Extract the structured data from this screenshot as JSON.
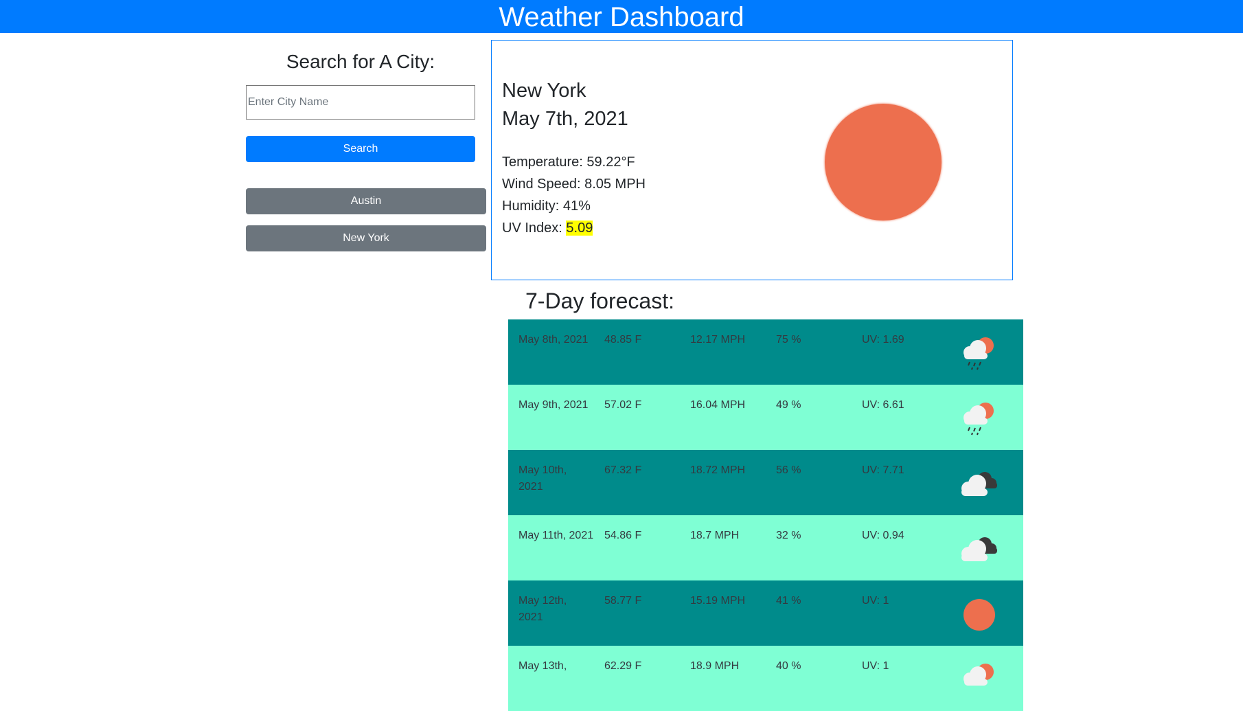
{
  "header": {
    "title": "Weather Dashboard"
  },
  "search": {
    "title": "Search for A City:",
    "placeholder": "Enter City Name",
    "value": "",
    "button_label": "Search"
  },
  "history": [
    "Austin",
    "New York"
  ],
  "current": {
    "city": "New York",
    "date": "May 7th, 2021",
    "temperature": "Temperature: 59.22°F",
    "wind": "Wind Speed: 8.05 MPH",
    "humidity": "Humidity: 41%",
    "uv_label": "UV Index: ",
    "uv_value": "5.09",
    "uv_highlight_color": "#ffff00",
    "icon": "sun-icon"
  },
  "forecast": {
    "title": "7-Day forecast:",
    "row_colors": [
      "#008b8b",
      "#7fffd4"
    ],
    "days": [
      {
        "date": "May 8th, 2021",
        "temp": "48.85 F",
        "wind": "12.17 MPH",
        "humidity": "75 %",
        "uv": "UV: 1.69",
        "icon": "rain-sun-icon"
      },
      {
        "date": "May 9th, 2021",
        "temp": "57.02 F",
        "wind": "16.04 MPH",
        "humidity": "49 %",
        "uv": "UV: 6.61",
        "icon": "rain-sun-icon"
      },
      {
        "date": "May 10th, 2021",
        "temp": "67.32 F",
        "wind": "18.72 MPH",
        "humidity": "56 %",
        "uv": "UV: 7.71",
        "icon": "cloudy-icon"
      },
      {
        "date": "May 11th, 2021",
        "temp": "54.86 F",
        "wind": "18.7 MPH",
        "humidity": "32 %",
        "uv": "UV: 0.94",
        "icon": "cloudy-icon"
      },
      {
        "date": "May 12th, 2021",
        "temp": "58.77 F",
        "wind": "15.19 MPH",
        "humidity": "41 %",
        "uv": "UV: 1",
        "icon": "sun-icon"
      },
      {
        "date": "May 13th,",
        "temp": "62.29 F",
        "wind": "18.9 MPH",
        "humidity": "40 %",
        "uv": "UV: 1",
        "icon": "partly-sunny-icon"
      }
    ]
  }
}
